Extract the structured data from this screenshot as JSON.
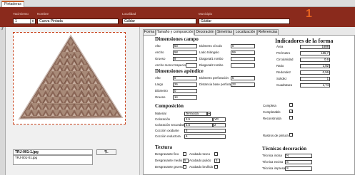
{
  "document_tab": "Pintaderas",
  "header": {
    "labels": {
      "yacimiento": "Yacimiento",
      "nombre": "Nombre",
      "localidad": "Localidad",
      "municipio": "Municipio"
    },
    "yacimiento_value": "1",
    "nombre_value": "Cueva Pintada",
    "localidad_value": "Gáldar",
    "municipio_value": "Gáldar",
    "record_number": "1"
  },
  "record_marker": "ℱ",
  "photo": {
    "filename": "TRJ-001-1.jpg",
    "file_list": "TRJ-001-01.jpg",
    "button": "¶L"
  },
  "tabs": [
    "Forma",
    "Tamaño y composición",
    "Decoración",
    "Simetrías",
    "Localización",
    "Referencias"
  ],
  "dim_campo": {
    "title": "Dimensiones campo",
    "alto_label": "Alto",
    "alto": "53",
    "ancho_label": "Ancho",
    "ancho": "58",
    "grueso_label": "Grueso",
    "grueso": "9",
    "ancho_menor_label": "Ancho menor trapecio",
    "ancho_menor": "",
    "diam_circulo_label": "Diámetro círculo",
    "diam_circulo": "0",
    "lado_triangulo_label": "Lado triángulo",
    "lado_triangulo": "59",
    "diagonal1_label": "Diagonal1 rombo",
    "diagonal1": "",
    "diagonal2_label": "Diagonal2 rombo",
    "diagonal2": ""
  },
  "dim_apendice": {
    "title": "Dimensiones apéndice",
    "alto_label": "Alto",
    "alto": "0",
    "largo_label": "Largo",
    "largo": "26",
    "diametro_label": "Diámetro",
    "diametro": "0",
    "grueso_label": "Grueso",
    "grueso": "14",
    "diam_perf_label": "Diámetro perforación",
    "diam_perf": "5",
    "dist_base_label": "Distancia base perforación",
    "dist_base": "23"
  },
  "indicadores": {
    "title": "Indicadores de la forma",
    "area_label": "Área",
    "area": "1688",
    "perimetro_label": "Perímetro",
    "perimetro": "185,7",
    "circularidad_label": "Circularidad",
    "circularidad": "0,6",
    "ratio_label": "Ratio",
    "ratio": "1,82",
    "redondez_label": "Redondez",
    "redondez": "0,56",
    "solidez_label": "Solidez",
    "solidez": "1",
    "cuadratura_label": "Cuadratura",
    "cuadratura": "1,74"
  },
  "composicion": {
    "title": "Composición",
    "material_label": "Material",
    "material": "Terracota",
    "coloracion_label": "Coloración",
    "coloracion": "2.5",
    "coloracion_b": "YR",
    "coloracion_sec_label": "Coloración secundaria",
    "coloracion_sec": "2.5",
    "coloracion_sec_b": "2",
    "coccion_oxidante_label": "Cocción oxidante",
    "coccion_oxidante": "5",
    "coccion_reductora_label": "Cocción reductora",
    "coccion_reductora": "6",
    "completa_label": "Completa",
    "completable_label": "Completable",
    "reconstruida_label": "Reconstruida",
    "rastros_label": "Rastros de pintura"
  },
  "textura": {
    "title": "Textura",
    "desgrasante_fino_label": "Desgrasante fino",
    "desgrasante_medio_label": "Desgrasante medio",
    "desgrasante_medio": "5",
    "desgrasante_grueso_label": "Desgrasante grueso",
    "acabado_tosco_label": "Acabado tosco",
    "acabado_pulido_label": "Acabado pulido",
    "acabado_pulido": "5",
    "acabado_brunido_label": "Acabado bruñido"
  },
  "tecnicas": {
    "title": "Técnicas decoración",
    "tecnica_incisa_label": "Técnica incisa",
    "tecnica_incisa": "N",
    "tecnica_excisa_label": "Técnica excisa",
    "tecnica_excisa": "S",
    "tecnica_impresa_label": "Técnica impresa",
    "tecnica_impresa": "S"
  },
  "colors": {
    "header_bg": "#8a2a1c",
    "accent_orange": "#e86420",
    "photo_border": "#c8401a"
  }
}
